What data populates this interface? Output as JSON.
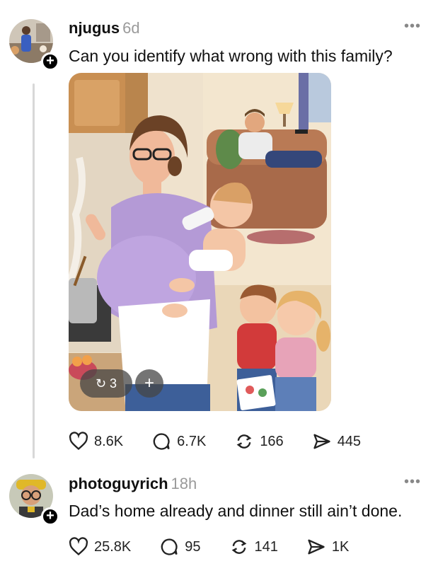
{
  "post": {
    "username": "njugus",
    "time": "6d",
    "text": "Can you identify what wrong with this family?",
    "media_badge": {
      "repost_count": "3",
      "add_label": "+"
    },
    "stats": {
      "likes": "8.6K",
      "comments": "6.7K",
      "reposts": "166",
      "shares": "445"
    }
  },
  "reply": {
    "username": "photoguyrich",
    "time": "18h",
    "text": "Dad’s home already and dinner still ain’t done.",
    "stats": {
      "likes": "25.8K",
      "comments": "95",
      "reposts": "141",
      "shares": "1K"
    }
  },
  "icons": [
    "heart-icon",
    "comment-icon",
    "repost-icon",
    "share-icon",
    "more-icon",
    "follow-plus-icon"
  ],
  "colors": {
    "text": "#111111",
    "muted": "#9a9a9a",
    "thread_line": "#d8d8d8"
  }
}
